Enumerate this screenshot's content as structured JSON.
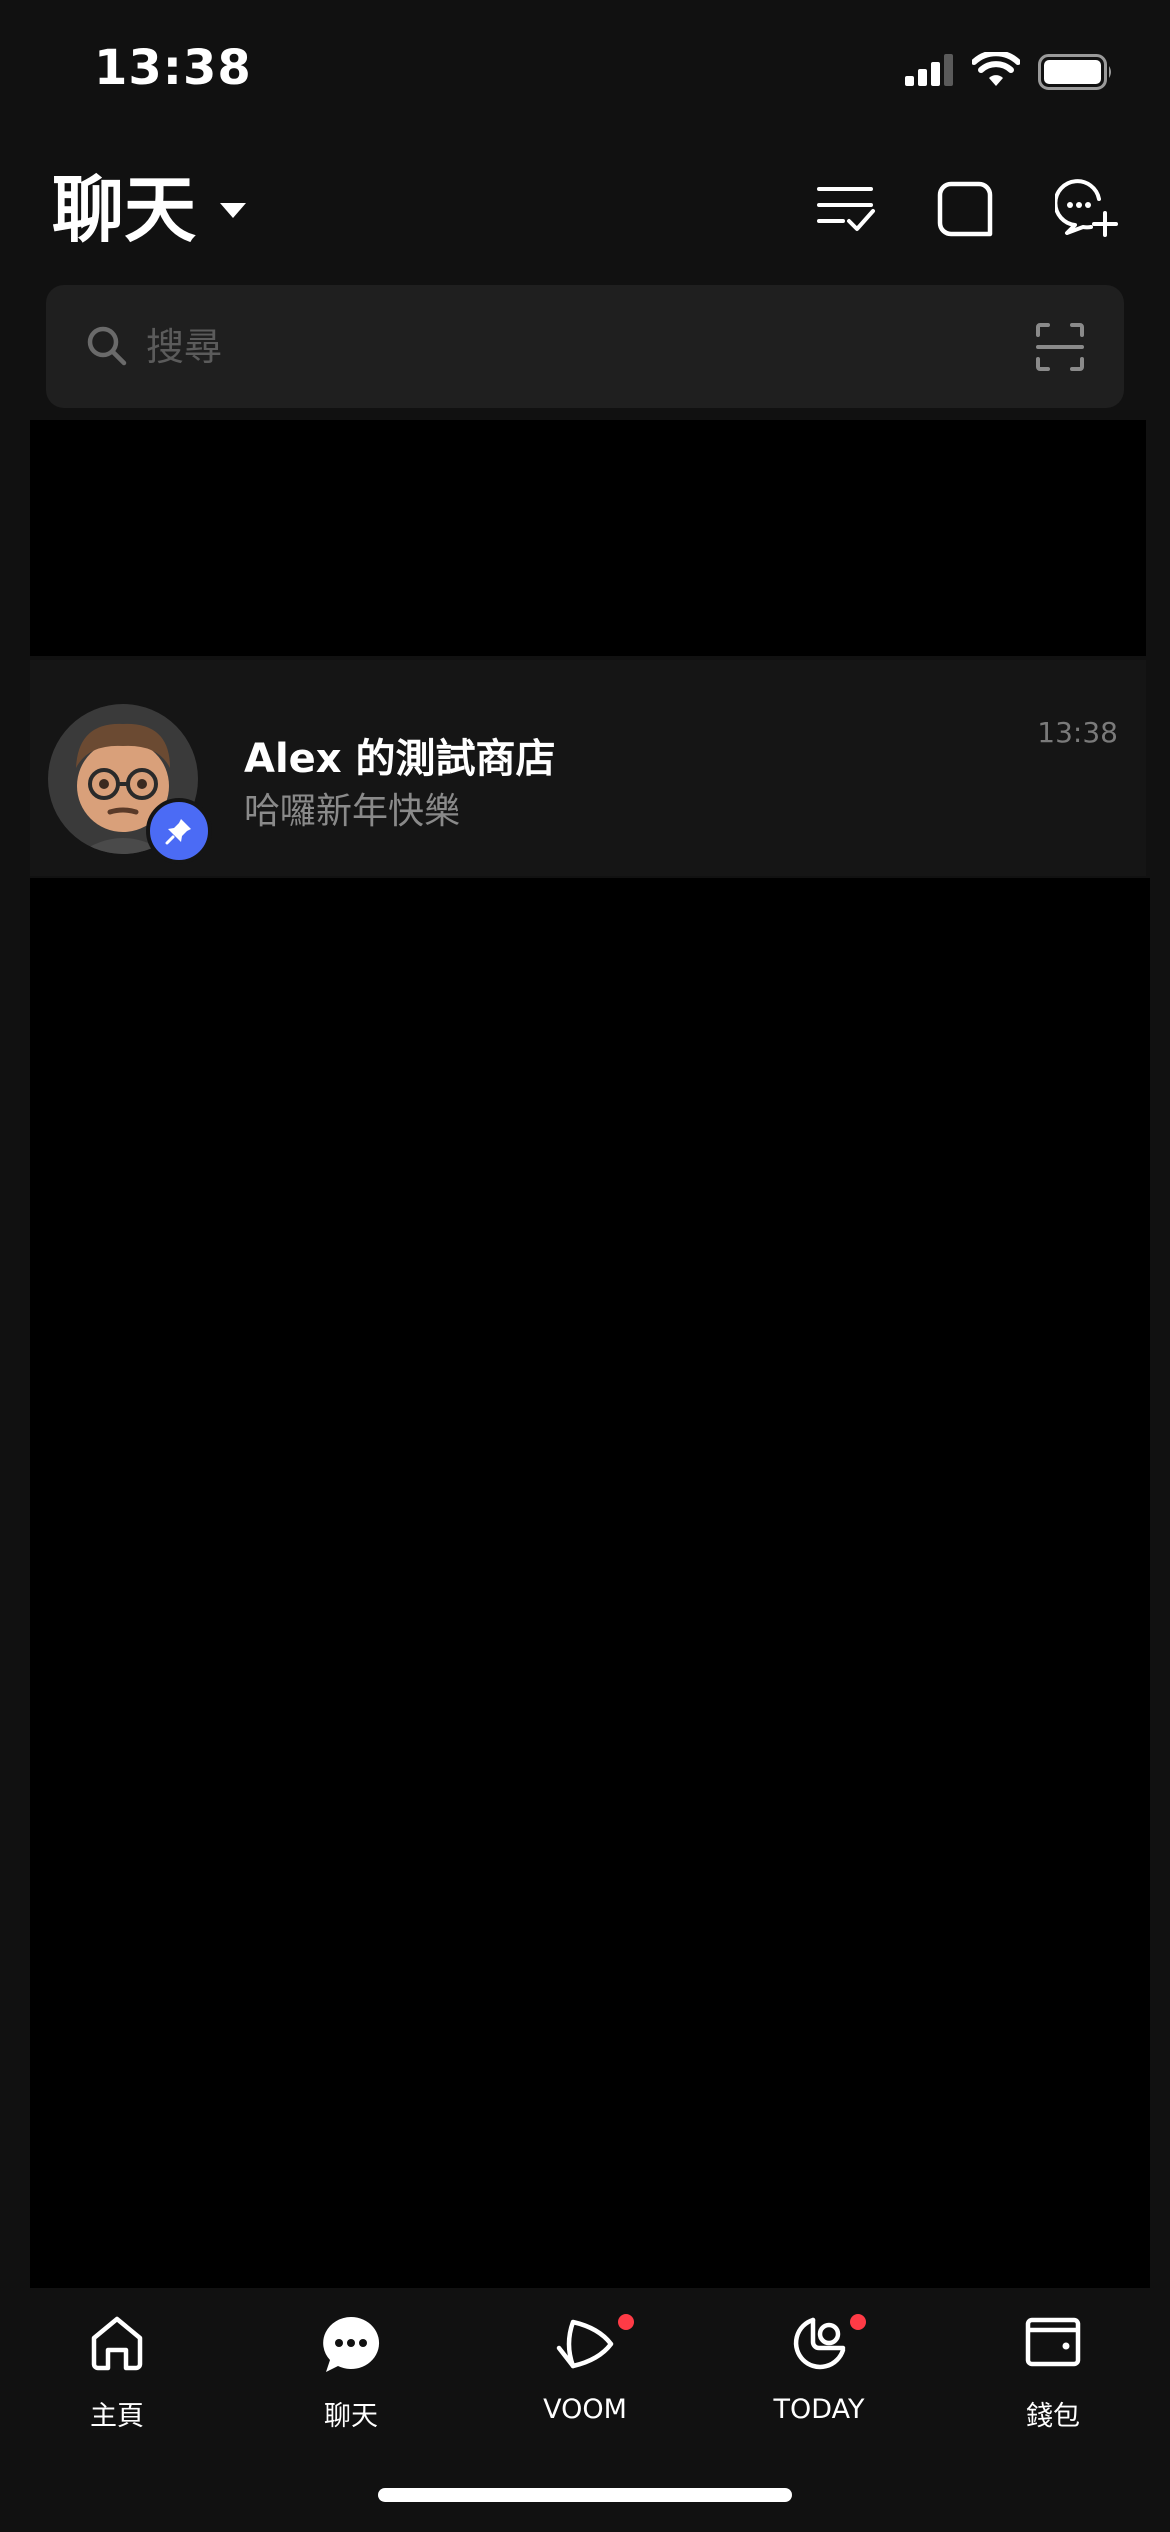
{
  "status_bar": {
    "time": "13:38",
    "icons": [
      "cellular-signal-icon",
      "wifi-icon",
      "battery-icon"
    ]
  },
  "header": {
    "title": "聊天",
    "actions": [
      "edit-list-icon",
      "square-icon",
      "new-chat-icon"
    ]
  },
  "search": {
    "placeholder": "搜尋",
    "value": ""
  },
  "chats": [
    {
      "name": "Alex 的測試商店",
      "preview": "哈囉新年快樂",
      "time": "13:38",
      "pinned": true
    }
  ],
  "tabs": [
    {
      "label": "主頁",
      "icon": "home-icon",
      "active": false,
      "badge": false
    },
    {
      "label": "聊天",
      "icon": "chat-bubble-icon",
      "active": true,
      "badge": false
    },
    {
      "label": "VOOM",
      "icon": "voom-play-icon",
      "active": false,
      "badge": true
    },
    {
      "label": "TODAY",
      "icon": "today-icon",
      "active": false,
      "badge": true
    },
    {
      "label": "錢包",
      "icon": "wallet-icon",
      "active": false,
      "badge": false
    }
  ],
  "colors": {
    "background": "#111111",
    "search_background": "#1f1f1f",
    "pin_badge": "#4b6bf5",
    "notification_dot": "#ff3b46",
    "secondary_text": "#8a8a8a"
  }
}
